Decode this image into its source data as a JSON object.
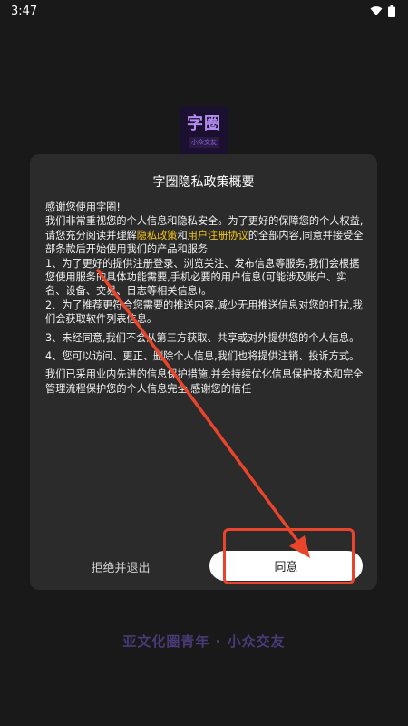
{
  "status_bar": {
    "time": "3:47"
  },
  "app_logo": {
    "line1": "字圈",
    "line2": "小众交友"
  },
  "dialog": {
    "title": "字圈隐私政策概要",
    "greeting": "感谢您使用字圈!",
    "p1_a": "我们非常重视您的个人信息和隐私安全。为了更好的保障您的个人权益,请您充分阅读并理解",
    "privacy_link": "隐私政策",
    "and": "和",
    "agreement_link": "用户注册协议",
    "p1_b": "的全部内容,同意并接受全部条款后开始使用我们的产品和服务",
    "item1": "1、为了更好的提供注册登录、浏览关注、发布信息等服务,我们会根据您使用服务的具体功能需要,手机必要的用户信息(可能涉及账户、实名、设备、交易、日志等相关信息)。",
    "item2": "2、为了推荐更符合您需要的推送内容,减少无用推送信息对您的打扰,我们会获取软件列表信息。",
    "item3": "3、未经同意,我们不会从第三方获取、共享或对外提供您的个人信息。",
    "item4": "4、您可以访问、更正、删除个人信息,我们也将提供注销、投诉方式。",
    "closing": "我们已采用业内先进的信息保护措施,并会持续优化信息保护技术和完全管理流程保护您的个人信息完全,感谢您的信任",
    "reject_label": "拒绝并退出",
    "agree_label": "同意"
  },
  "slogan": "亚文化圈青年 · 小众交友",
  "colors": {
    "background": "#191919",
    "dialog": "#2b2b2b",
    "link": "#f5c518",
    "annotation": "#e8452c",
    "slogan": "#4b3a78"
  }
}
